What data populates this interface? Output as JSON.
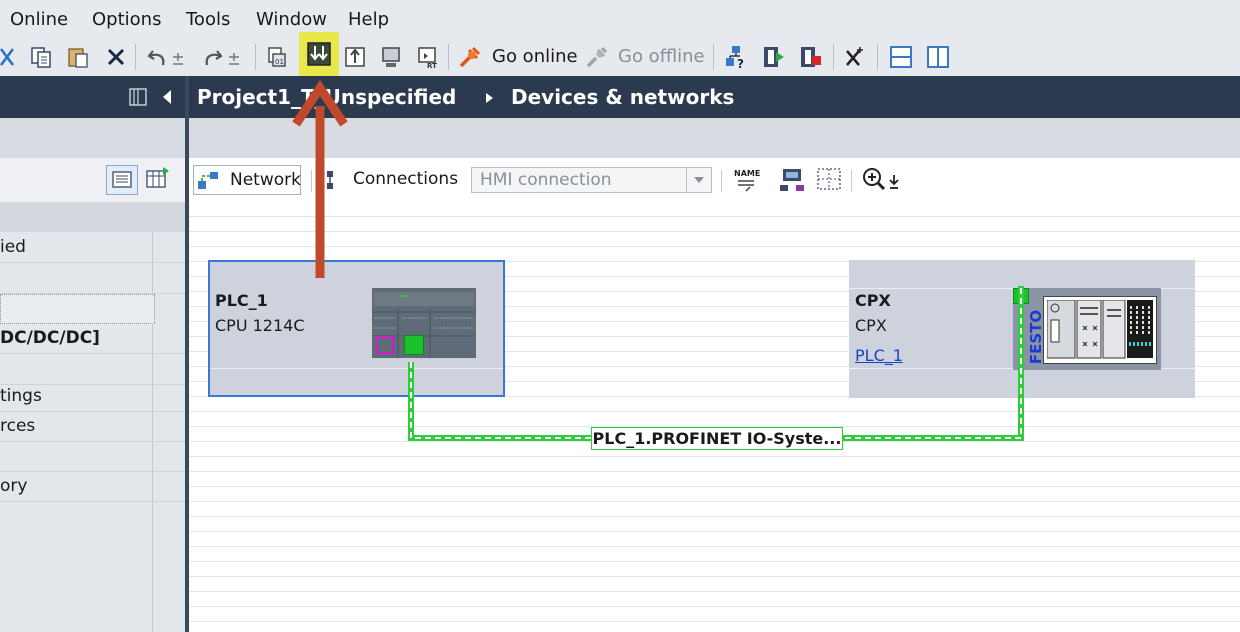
{
  "menu": {
    "items": [
      "Online",
      "Options",
      "Tools",
      "Window",
      "Help"
    ]
  },
  "toolbar": {
    "go_online_label": "Go online",
    "go_offline_label": "Go offline",
    "highlighted_button": "download-to-device",
    "highlight_color": "#e8e84a"
  },
  "left_panel": {
    "rows": [
      "ied",
      "",
      "",
      "DC/DC/DC]",
      "",
      "tings",
      "rces",
      "",
      "ory"
    ]
  },
  "title_bar": {
    "project": "Project1_T",
    "project_tail": "_Unspecified",
    "section": "Devices & networks"
  },
  "canvas_toolbar": {
    "network_label": "Network",
    "connections_label": "Connections",
    "connection_type_value": "HMI connection"
  },
  "devices": {
    "plc": {
      "name": "PLC_1",
      "type": "CPU 1214C"
    },
    "cpx": {
      "name": "CPX",
      "type": "CPX",
      "link": "PLC_1",
      "brand": "FESTO"
    }
  },
  "network": {
    "label": "PLC_1.PROFINET IO-Syste...",
    "color": "#2fcc3c"
  },
  "annotation": {
    "arrow_color": "#c1492b"
  }
}
